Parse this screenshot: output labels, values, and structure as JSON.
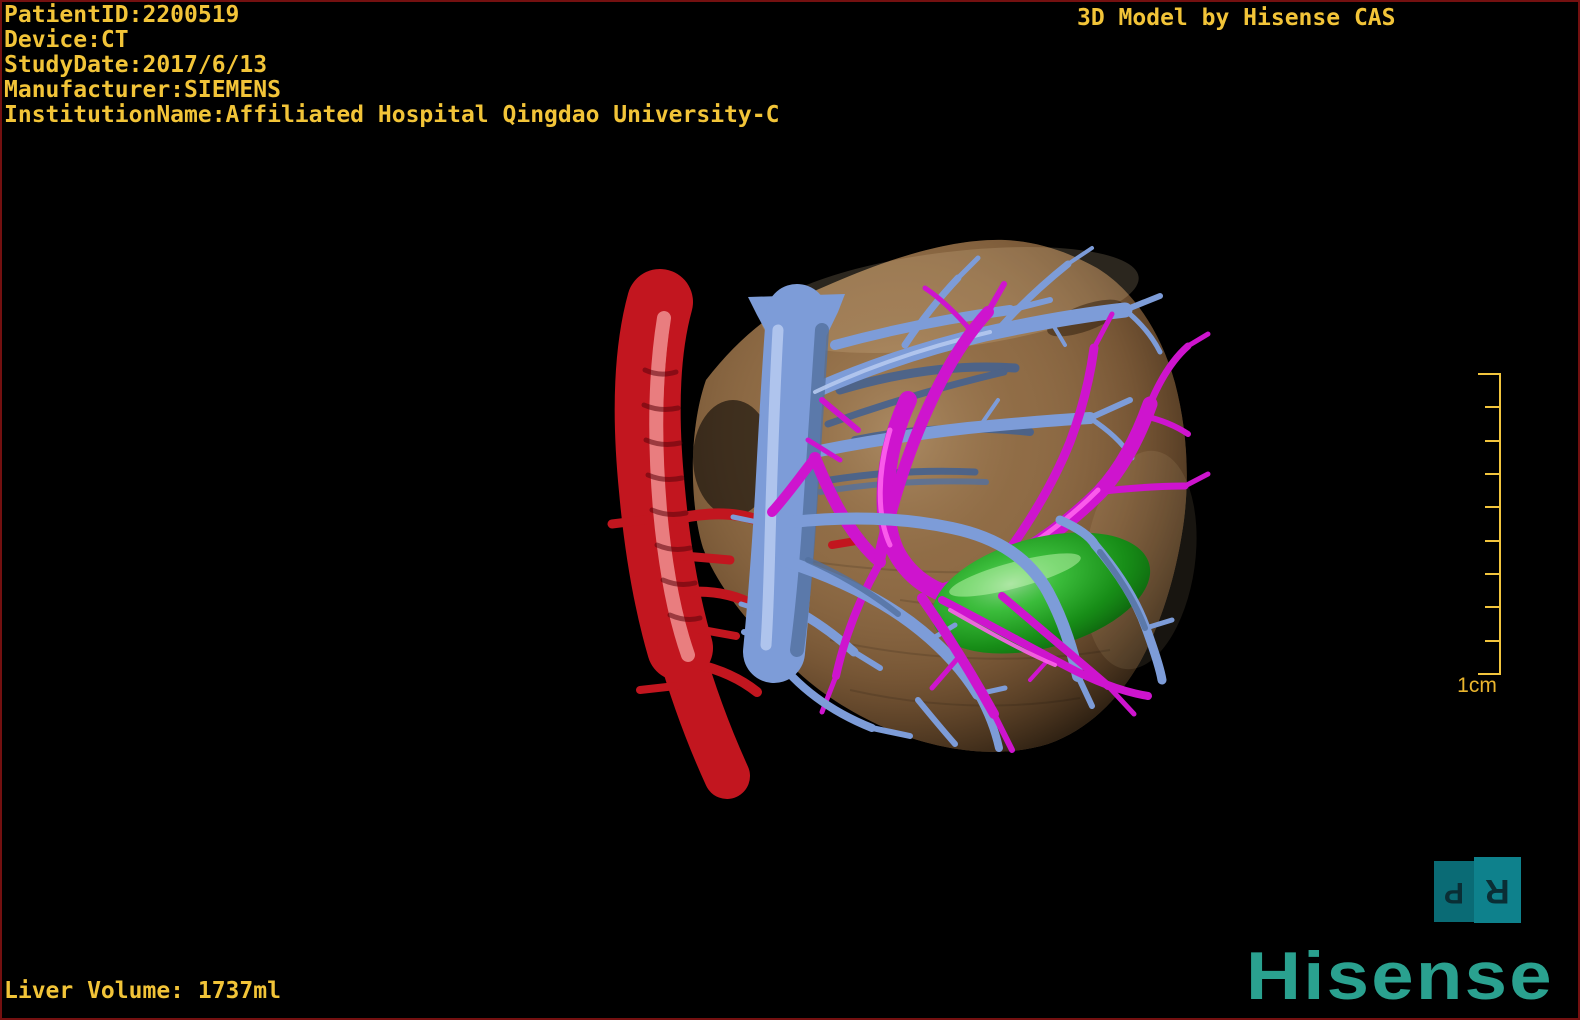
{
  "frame": {
    "border_color": "#741010",
    "background": "#000000"
  },
  "overlay": {
    "text_color": "#f2c438",
    "patient_lines": [
      "PatientID:2200519",
      "Device:CT",
      "StudyDate:2017/6/13",
      "Manufacturer:SIEMENS",
      "InstitutionName:Affiliated Hospital Qingdao University-C"
    ],
    "title": "3D Model by Hisense CAS",
    "liver_volume": "Liver Volume: 1737ml"
  },
  "scale_bar": {
    "label": "1cm",
    "ticks": 10,
    "color": "#f2c53d"
  },
  "orientation_cube": {
    "left_letter": "P",
    "right_letter": "R",
    "left_face_color": "#0a6b75",
    "right_face_color": "#0e818c",
    "letter_color": "#0a2e35"
  },
  "logo": {
    "text": "Hisense",
    "color": "#2aa18f"
  },
  "model": {
    "structures": {
      "liver": {
        "color": "#8a6742"
      },
      "aorta": {
        "color": "#c2161f",
        "highlight": "#f09090",
        "rib": "#5c040c"
      },
      "portal_vein": {
        "color": "#7d9cd8",
        "highlight": "#b5c9f0",
        "shadow": "#53719f"
      },
      "hepatic_veins": {
        "color": "#46628f"
      },
      "hepatic_artery": {
        "color": "#ce14ce",
        "highlight": "#ff62ee"
      },
      "gallbladder": {
        "color": "#1fa51f",
        "highlight": "#86ff86"
      }
    }
  }
}
